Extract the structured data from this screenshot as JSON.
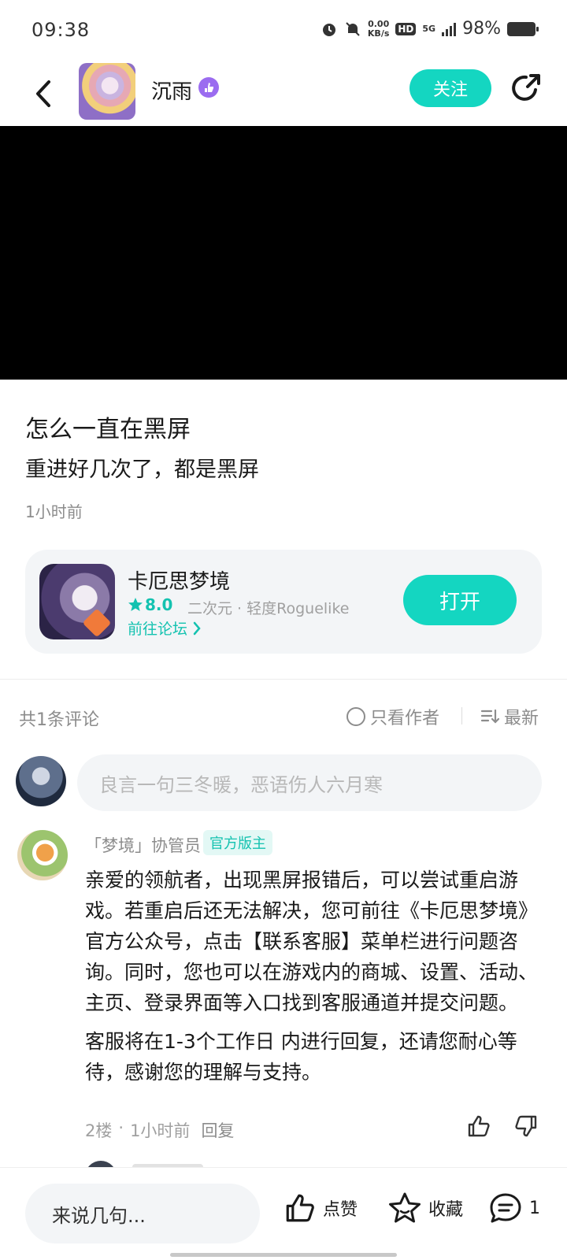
{
  "status_bar": {
    "time": "09:38",
    "net_speed_value": "0.00",
    "net_speed_unit": "KB/s",
    "hd": "HD",
    "network": "5G",
    "battery": "98%",
    "icons": [
      "alarm-icon",
      "mute-bell-icon",
      "signal-icon",
      "battery-icon"
    ]
  },
  "header": {
    "user_name": "沉雨",
    "follow_label": "关注",
    "icons": [
      "back-icon",
      "verified-icon",
      "share-icon"
    ]
  },
  "post": {
    "title": "怎么一直在黑屏",
    "body": "重进好几次了，都是黑屏",
    "time": "1小时前"
  },
  "game_card": {
    "name": "卡厄思梦境",
    "rating": "8.0",
    "tags": "二次元 · 轻度Roguelike",
    "forum_link": "前往论坛",
    "open_label": "打开"
  },
  "comments_header": {
    "count": "共1条评论",
    "author_only": "只看作者",
    "sort": "最新"
  },
  "comment_input": {
    "placeholder": "良言一句三冬暖，恶语伤人六月寒"
  },
  "comments": [
    {
      "name": "「梦境」协管员",
      "badge": "官方版主",
      "paragraph1": "亲爱的领航者，出现黑屏报错后，可以尝试重启游戏。若重启后还无法解决，您可前往《卡厄思梦境》官方公众号，点击【联系客服】菜单栏进行问题咨询。同时，您也可以在游戏内的商城、设置、活动、主页、登录界面等入口找到客服通道并提交问题。",
      "paragraph2": "客服将在1-3个工作日 内进行回复，还请您耐心等待，感谢您的理解与支持。",
      "floor": "2楼",
      "time": "1小时前",
      "reply": "回复"
    }
  ],
  "bottom_bar": {
    "input_placeholder": "来说几句...",
    "like_label": "点赞",
    "fav_label": "收藏",
    "comment_count": "1"
  },
  "colors": {
    "accent": "#14d6c1",
    "accent_text": "#14c2b0",
    "verified": "#9b6cf0",
    "muted": "#8c8c8c"
  }
}
